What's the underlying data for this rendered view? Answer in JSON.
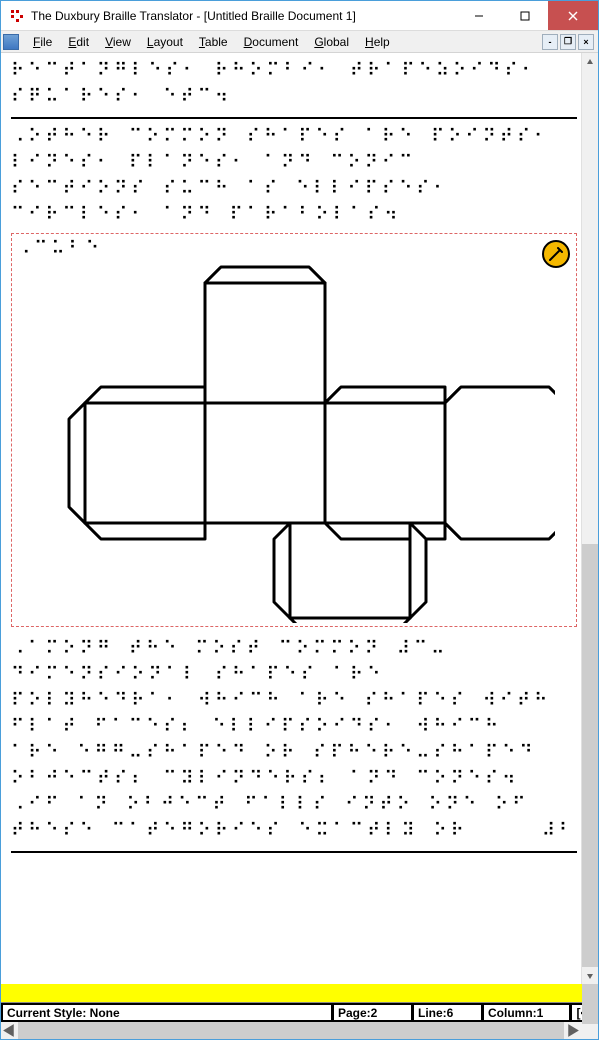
{
  "titlebar": {
    "title": "The Duxbury Braille Translator - [Untitled Braille Document 1]"
  },
  "menu": {
    "file": "File",
    "edit": "Edit",
    "view": "View",
    "layout": "Layout",
    "table": "Table",
    "document": "Document",
    "global": "Global",
    "help": "Help"
  },
  "braille": {
    "block1_l1": "⠗⠑⠉⠞⠁⠝⠛⠇⠑⠎⠂ ⠗⠓⠕⠍⠃⠊⠂ ⠞⠗⠁⠏⠑⠵⠕⠊⠙⠎⠂",
    "block1_l2": "⠎⠟⠥⠁⠗⠑⠎⠂ ⠑⠞⠉⠲",
    "block2_l1": "⠠⠕⠞⠓⠑⠗ ⠉⠕⠍⠍⠕⠝ ⠎⠓⠁⠏⠑⠎ ⠁⠗⠑ ⠏⠕⠊⠝⠞⠎⠂",
    "block2_l2": "⠇⠊⠝⠑⠎⠂ ⠏⠇⠁⠝⠑⠎⠂ ⠁⠝⠙ ⠉⠕⠝⠊⠉",
    "block2_l3": "⠎⠑⠉⠞⠊⠕⠝⠎ ⠎⠥⠉⠓ ⠁⠎ ⠑⠇⠇⠊⠏⠎⠑⠎⠂",
    "block2_l4": "⠉⠊⠗⠉⠇⠑⠎⠂ ⠁⠝⠙ ⠏⠁⠗⠁⠃⠕⠇⠁⠎⠲",
    "graphic_label": "⠠⠉⠥⠃⠑",
    "block3_l1": "⠠⠁⠍⠕⠝⠛ ⠞⠓⠑ ⠍⠕⠎⠞ ⠉⠕⠍⠍⠕⠝ ⠼⠉⠤",
    "block3_l2": "⠙⠊⠍⠑⠝⠎⠊⠕⠝⠁⠇ ⠎⠓⠁⠏⠑⠎ ⠁⠗⠑",
    "block3_l3": "⠏⠕⠇⠽⠓⠑⠙⠗⠁⠂ ⠺⠓⠊⠉⠓ ⠁⠗⠑ ⠎⠓⠁⠏⠑⠎ ⠺⠊⠞⠓",
    "block3_l4": "⠋⠇⠁⠞ ⠋⠁⠉⠑⠎⠆ ⠑⠇⠇⠊⠏⠎⠕⠊⠙⠎⠂ ⠺⠓⠊⠉⠓",
    "block3_l5": "⠁⠗⠑ ⠑⠛⠛⠤⠎⠓⠁⠏⠑⠙ ⠕⠗ ⠎⠏⠓⠑⠗⠑⠤⠎⠓⠁⠏⠑⠙",
    "block3_l6": "⠕⠃⠚⠑⠉⠞⠎⠆ ⠉⠽⠇⠊⠝⠙⠑⠗⠎⠆ ⠁⠝⠙ ⠉⠕⠝⠑⠎⠲",
    "block3_l7": "⠠⠊⠋ ⠁⠝ ⠕⠃⠚⠑⠉⠞ ⠋⠁⠇⠇⠎ ⠊⠝⠞⠕ ⠕⠝⠑ ⠕⠋",
    "block3_l8": "⠞⠓⠑⠎⠑ ⠉⠁⠞⠑⠛⠕⠗⠊⠑⠎ ⠑⠭⠁⠉⠞⠇⠽ ⠕⠗     ⠼⠃"
  },
  "status": {
    "style_label": "Current Style: None",
    "page": "Page:2",
    "line": "Line:6",
    "column": "Column:1",
    "indicator": "[<]"
  }
}
